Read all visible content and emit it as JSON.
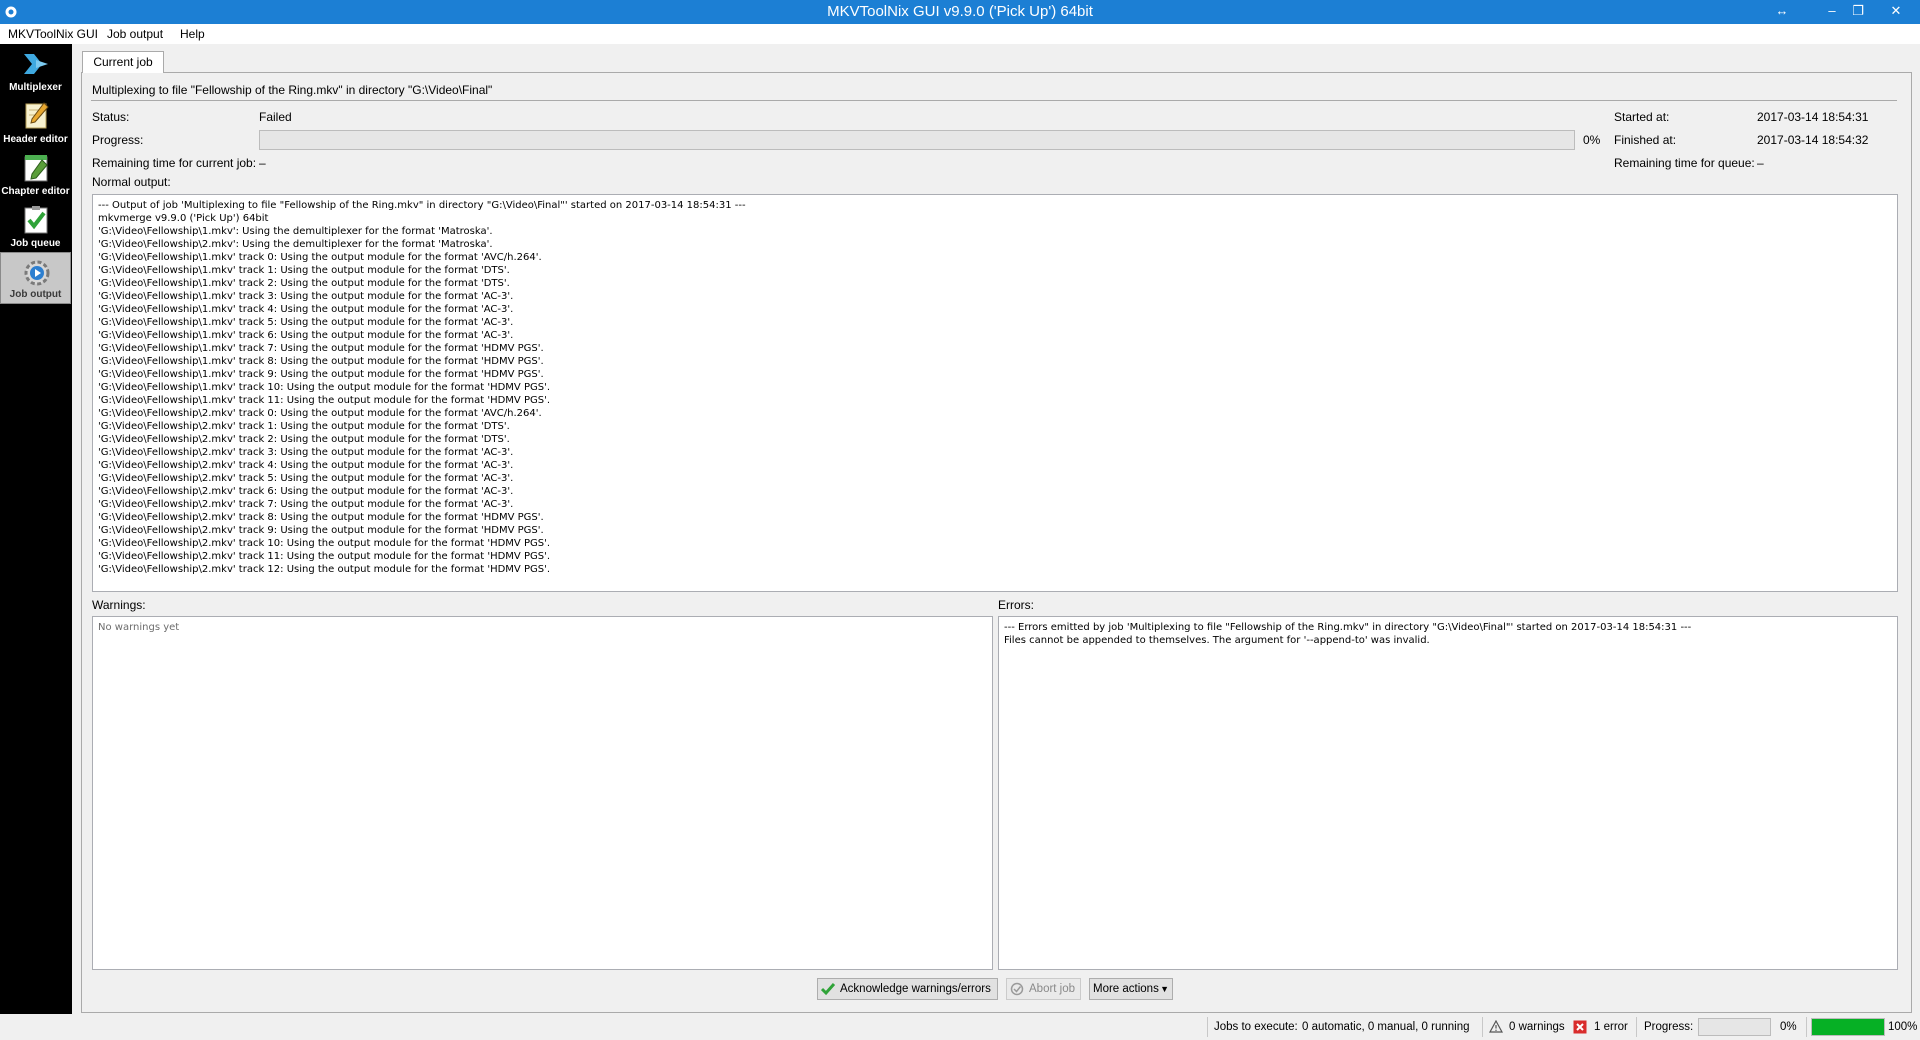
{
  "window": {
    "title": "MKVToolNix GUI v9.9.0 ('Pick Up') 64bit",
    "title_color": "#1c7fd4",
    "controls": {
      "restore_extra": "↔",
      "minimize": "–",
      "maximize": "❐",
      "close": "✕"
    }
  },
  "menu": [
    "MKVToolNix GUI",
    "Job output",
    "Help"
  ],
  "sidebar": {
    "items": [
      {
        "label": "Multiplexer",
        "icon": "multiplexer-icon",
        "active": false
      },
      {
        "label": "Header editor",
        "icon": "header-editor-icon",
        "active": false
      },
      {
        "label": "Chapter editor",
        "icon": "chapter-editor-icon",
        "active": false
      },
      {
        "label": "Job queue",
        "icon": "job-queue-icon",
        "active": false
      },
      {
        "label": "Job output",
        "icon": "job-output-icon",
        "active": true
      }
    ]
  },
  "tab": {
    "label": "Current job"
  },
  "job": {
    "description": "Multiplexing to file \"Fellowship of the Ring.mkv\" in directory \"G:\\Video\\Final\"",
    "status_label": "Status:",
    "status_value": "Failed",
    "progress_label": "Progress:",
    "progress_value": "0%",
    "progress_fraction": 0,
    "remaining_label": "Remaining time for current job:",
    "remaining_value": "–",
    "started_label": "Started at:",
    "started_value": "2017-03-14 18:54:31",
    "finished_label": "Finished at:",
    "finished_value": "2017-03-14 18:54:32",
    "remaining_queue_label": "Remaining time for queue:",
    "remaining_queue_value": "–"
  },
  "output": {
    "normal_label": "Normal output:",
    "normal_text": "--- Output of job 'Multiplexing to file \"Fellowship of the Ring.mkv\" in directory \"G:\\Video\\Final\"' started on 2017-03-14 18:54:31 ---\nmkvmerge v9.9.0 ('Pick Up') 64bit\n'G:\\Video\\Fellowship\\1.mkv': Using the demultiplexer for the format 'Matroska'.\n'G:\\Video\\Fellowship\\2.mkv': Using the demultiplexer for the format 'Matroska'.\n'G:\\Video\\Fellowship\\1.mkv' track 0: Using the output module for the format 'AVC/h.264'.\n'G:\\Video\\Fellowship\\1.mkv' track 1: Using the output module for the format 'DTS'.\n'G:\\Video\\Fellowship\\1.mkv' track 2: Using the output module for the format 'DTS'.\n'G:\\Video\\Fellowship\\1.mkv' track 3: Using the output module for the format 'AC-3'.\n'G:\\Video\\Fellowship\\1.mkv' track 4: Using the output module for the format 'AC-3'.\n'G:\\Video\\Fellowship\\1.mkv' track 5: Using the output module for the format 'AC-3'.\n'G:\\Video\\Fellowship\\1.mkv' track 6: Using the output module for the format 'AC-3'.\n'G:\\Video\\Fellowship\\1.mkv' track 7: Using the output module for the format 'HDMV PGS'.\n'G:\\Video\\Fellowship\\1.mkv' track 8: Using the output module for the format 'HDMV PGS'.\n'G:\\Video\\Fellowship\\1.mkv' track 9: Using the output module for the format 'HDMV PGS'.\n'G:\\Video\\Fellowship\\1.mkv' track 10: Using the output module for the format 'HDMV PGS'.\n'G:\\Video\\Fellowship\\1.mkv' track 11: Using the output module for the format 'HDMV PGS'.\n'G:\\Video\\Fellowship\\2.mkv' track 0: Using the output module for the format 'AVC/h.264'.\n'G:\\Video\\Fellowship\\2.mkv' track 1: Using the output module for the format 'DTS'.\n'G:\\Video\\Fellowship\\2.mkv' track 2: Using the output module for the format 'DTS'.\n'G:\\Video\\Fellowship\\2.mkv' track 3: Using the output module for the format 'AC-3'.\n'G:\\Video\\Fellowship\\2.mkv' track 4: Using the output module for the format 'AC-3'.\n'G:\\Video\\Fellowship\\2.mkv' track 5: Using the output module for the format 'AC-3'.\n'G:\\Video\\Fellowship\\2.mkv' track 6: Using the output module for the format 'AC-3'.\n'G:\\Video\\Fellowship\\2.mkv' track 7: Using the output module for the format 'AC-3'.\n'G:\\Video\\Fellowship\\2.mkv' track 8: Using the output module for the format 'HDMV PGS'.\n'G:\\Video\\Fellowship\\2.mkv' track 9: Using the output module for the format 'HDMV PGS'.\n'G:\\Video\\Fellowship\\2.mkv' track 10: Using the output module for the format 'HDMV PGS'.\n'G:\\Video\\Fellowship\\2.mkv' track 11: Using the output module for the format 'HDMV PGS'.\n'G:\\Video\\Fellowship\\2.mkv' track 12: Using the output module for the format 'HDMV PGS'.",
    "warnings_label": "Warnings:",
    "warnings_text": "No warnings yet",
    "errors_label": "Errors:",
    "errors_text": "--- Errors emitted by job 'Multiplexing to file \"Fellowship of the Ring.mkv\" in directory \"G:\\Video\\Final\"' started on 2017-03-14 18:54:31 ---\nFiles cannot be appended to themselves. The argument for '--append-to' was invalid."
  },
  "buttons": {
    "acknowledge": "Acknowledge warnings/errors",
    "abort": "Abort job",
    "more_actions": "More actions"
  },
  "statusbar": {
    "jobs_label": "Jobs to execute:",
    "jobs_value": "0 automatic, 0 manual, 0 running",
    "warnings": "0 warnings",
    "errors": "1 error",
    "progress_label": "Progress:",
    "progress_value": "0%",
    "progress_fraction": 0,
    "total_value": "100%",
    "total_fraction": 1.0,
    "accent_green": "#06b025",
    "error_red": "#d92c2c"
  }
}
